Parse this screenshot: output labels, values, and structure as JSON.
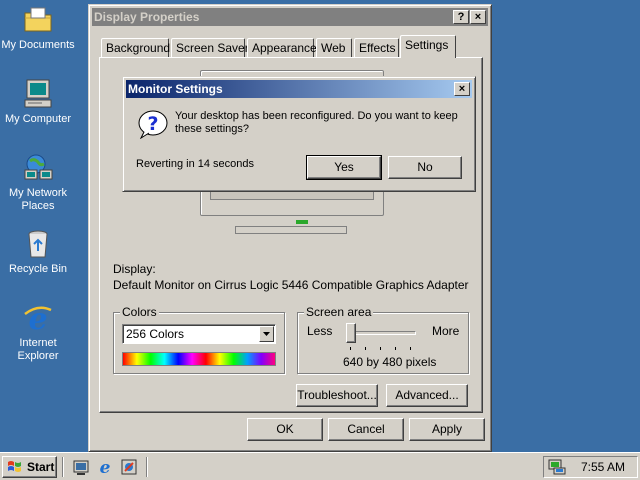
{
  "desktop": {
    "icons": [
      {
        "label": "My Documents",
        "icon": "folder-icon"
      },
      {
        "label": "My Computer",
        "icon": "computer-icon"
      },
      {
        "label_line1": "My Network",
        "label_line2": "Places",
        "icon": "network-icon"
      },
      {
        "label": "Recycle Bin",
        "icon": "recycle-bin-icon"
      },
      {
        "label_line1": "Internet",
        "label_line2": "Explorer",
        "icon": "internet-explorer-icon"
      }
    ]
  },
  "window": {
    "title": "Display Properties",
    "help_glyph": "?",
    "close_glyph": "×",
    "tabs": [
      "Background",
      "Screen Saver",
      "Appearance",
      "Web",
      "Effects",
      "Settings"
    ],
    "active_tab": "Settings",
    "display_label": "Display:",
    "display_value": "Default Monitor on Cirrus Logic 5446 Compatible Graphics Adapter",
    "colors": {
      "legend": "Colors",
      "selected": "256 Colors"
    },
    "screen_area": {
      "legend": "Screen area",
      "less": "Less",
      "more": "More",
      "value_text": "640 by 480 pixels",
      "slider_position_fraction": 0
    },
    "buttons": {
      "troubleshoot": "Troubleshoot...",
      "advanced": "Advanced...",
      "ok": "OK",
      "cancel": "Cancel",
      "apply": "Apply"
    }
  },
  "dialog": {
    "title": "Monitor Settings",
    "close_glyph": "×",
    "message_line1": "Your desktop has been reconfigured.  Do you want to keep",
    "message_line2": "these settings?",
    "countdown": "Reverting in 14 seconds",
    "yes": "Yes",
    "no": "No"
  },
  "taskbar": {
    "start": "Start",
    "clock": "7:55 AM",
    "quick_launch": [
      "desktop-icon",
      "internet-explorer-icon",
      "channels-icon"
    ]
  },
  "colors": {
    "desktop": "#3a6ea5",
    "face": "#d4d0c8",
    "active_title": "#0a246a",
    "inactive_title": "#808080"
  }
}
